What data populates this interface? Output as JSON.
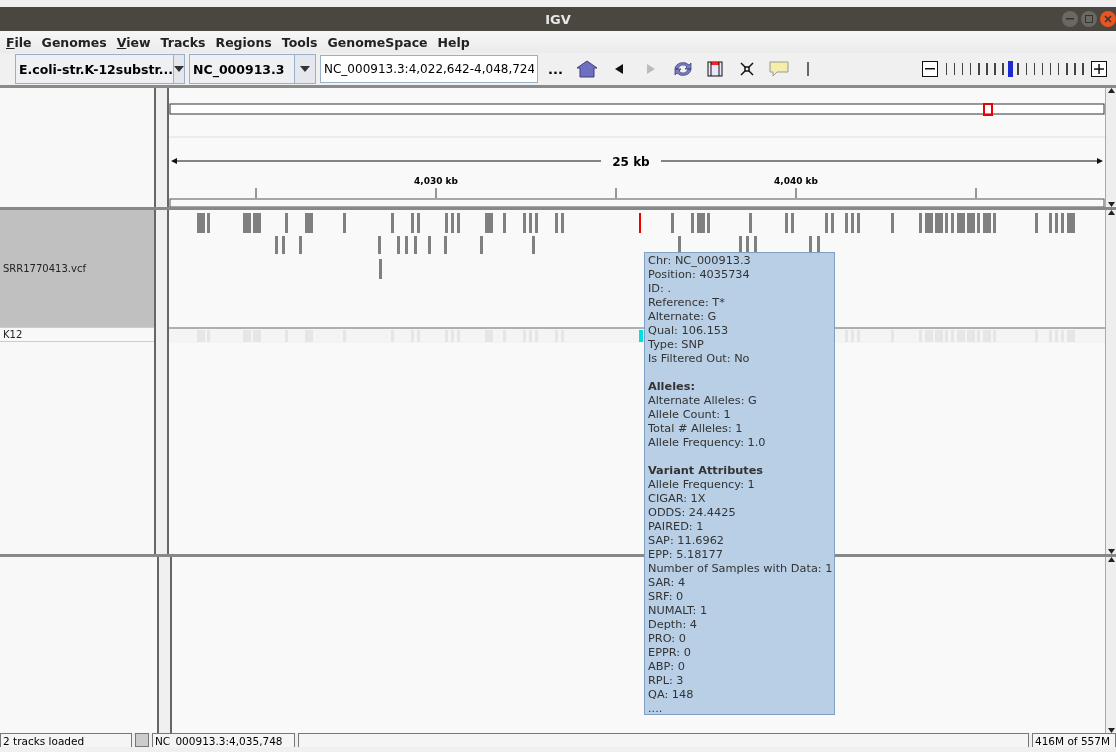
{
  "window": {
    "title": "IGV"
  },
  "menu": [
    {
      "label": "File",
      "underlined": true
    },
    {
      "label": "Genomes",
      "underlined": false
    },
    {
      "label": "View",
      "underlined": true
    },
    {
      "label": "Tracks",
      "underlined": false
    },
    {
      "label": "Regions",
      "underlined": false
    },
    {
      "label": "Tools",
      "underlined": false
    },
    {
      "label": "GenomeSpace",
      "underlined": false
    },
    {
      "label": "Help",
      "underlined": false
    }
  ],
  "toolbar": {
    "genome": "E.coli-str.K-12substr...",
    "chromosome": "NC_000913.3",
    "locus": "NC_000913.3:4,022,642-4,048,724",
    "more": "...",
    "forward_disabled": true,
    "zoom": {
      "level": 0.47
    }
  },
  "ruler": {
    "span": "25 kb",
    "labels": [
      "4,030 kb",
      "4,040 kb"
    ]
  },
  "tracks": [
    {
      "name": "SRR1770413.vcf",
      "selected": true
    },
    {
      "name": "K12",
      "selected": false
    }
  ],
  "tooltip": {
    "sections": [
      {
        "lines": [
          "Chr: NC_000913.3",
          "Position: 4035734",
          "ID: .",
          "Reference: T*",
          "Alternate: G",
          "Qual: 106.153",
          "Type: SNP",
          "Is Filtered Out: No"
        ]
      },
      {
        "heading": "Alleles:",
        "lines": [
          "Alternate Alleles: G",
          "Allele Count: 1",
          "Total # Alleles: 1",
          "Allele Frequency: 1.0"
        ]
      },
      {
        "heading": "Variant Attributes",
        "lines": [
          "Allele Frequency: 1",
          "CIGAR: 1X",
          "ODDS: 24.4425",
          "PAIRED: 1",
          "SAP: 11.6962",
          "EPP: 5.18177",
          "Number of Samples with Data: 1",
          "SAR: 4",
          "SRF: 0",
          "NUMALT: 1",
          "Depth: 4",
          "PRO: 0",
          "EPPR: 0",
          "ABP: 0",
          "RPL: 3",
          "QA: 148",
          "...."
        ]
      }
    ]
  },
  "status_bar": {
    "message": "2 tracks loaded",
    "position": "NC_000913.3:4,035,748",
    "memory": "416M of 557M"
  }
}
